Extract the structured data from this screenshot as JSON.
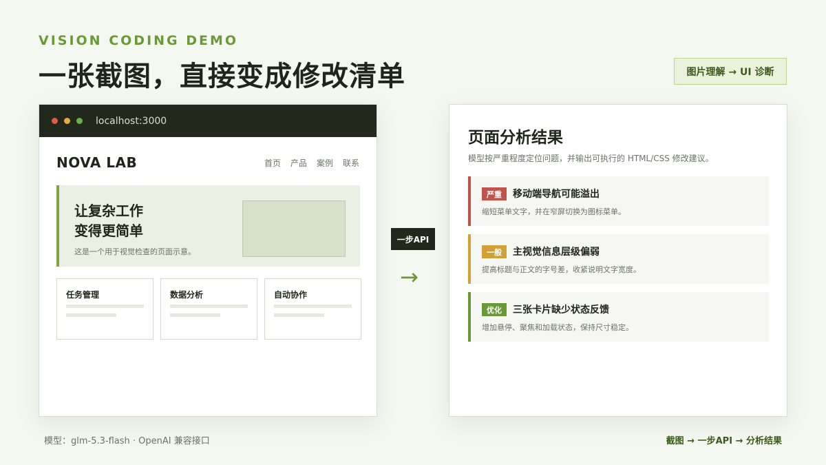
{
  "header": {
    "eyebrow": "VISION CODING DEMO",
    "title": "一张截图，直接变成修改清单",
    "tag": "图片理解 → UI 诊断"
  },
  "browser": {
    "url": "localhost:3000",
    "dot_colors": [
      "#e05a4c",
      "#e0b03c",
      "#6ab04c"
    ],
    "logo": "NOVA LAB",
    "nav": [
      "首页",
      "产品",
      "案例",
      "联系"
    ],
    "hero": {
      "title_line1": "让复杂工作",
      "title_line2": "变得更简单",
      "subtitle": "这是一个用于视觉检查的页面示意。"
    },
    "cards": [
      "任务管理",
      "数据分析",
      "自动协作"
    ]
  },
  "connector": {
    "badge": "一步API",
    "arrow": "→"
  },
  "panel": {
    "title": "页面分析结果",
    "subtitle": "模型按严重程度定位问题，并输出可执行的 HTML/CSS 修改建议。",
    "issues": [
      {
        "badge": "严重",
        "badge_color": "#c0534a",
        "title": "移动端导航可能溢出",
        "desc": "缩短菜单文字，并在窄屏切换为图标菜单。"
      },
      {
        "badge": "一般",
        "badge_color": "#d1a037",
        "title": "主视觉信息层级偏弱",
        "desc": "提高标题与正文的字号差，收紧说明文字宽度。"
      },
      {
        "badge": "优化",
        "badge_color": "#6a9a35",
        "title": "三张卡片缺少状态反馈",
        "desc": "增加悬停、聚焦和加载状态，保持尺寸稳定。"
      }
    ]
  },
  "footer": {
    "left": "模型：glm-5.3-flash · OpenAI 兼容接口",
    "right": "截图 → 一步API → 分析结果"
  }
}
